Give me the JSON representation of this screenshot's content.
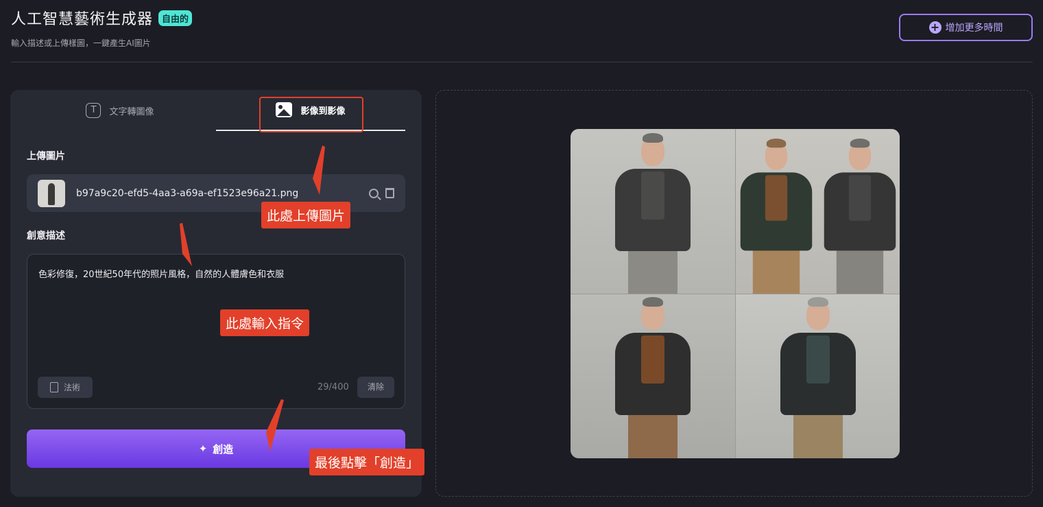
{
  "header": {
    "title": "人工智慧藝術生成器",
    "badge": "自由的",
    "subtitle": "輸入描述或上傳樣圖，一鍵產生AI圖片",
    "more_time_label": "增加更多時間"
  },
  "tabs": [
    {
      "label": "文字轉圖像",
      "icon": "text-icon",
      "active": false
    },
    {
      "label": "影像到影像",
      "icon": "image-icon",
      "active": true
    }
  ],
  "upload": {
    "label": "上傳圖片",
    "filename": "b97a9c20-efd5-4aa3-a69a-ef1523e96a21.png"
  },
  "prompt": {
    "label": "創意描述",
    "value": "色彩修復，20世紀50年代的照片風格，自然的人體膚色和衣服",
    "counter": "29/400",
    "spell_label": "法術",
    "clear_label": "清除"
  },
  "create_label": "創造",
  "annotations": {
    "upload_hint": "此處上傳圖片",
    "prompt_hint": "此處輸入指令",
    "create_hint": "最後點擊「創造」"
  },
  "colors": {
    "background": "#1c1c24",
    "panel": "#272a33",
    "accent": "#9b7cf5",
    "badge": "#4ee6d6",
    "annotation": "#e2402a"
  }
}
